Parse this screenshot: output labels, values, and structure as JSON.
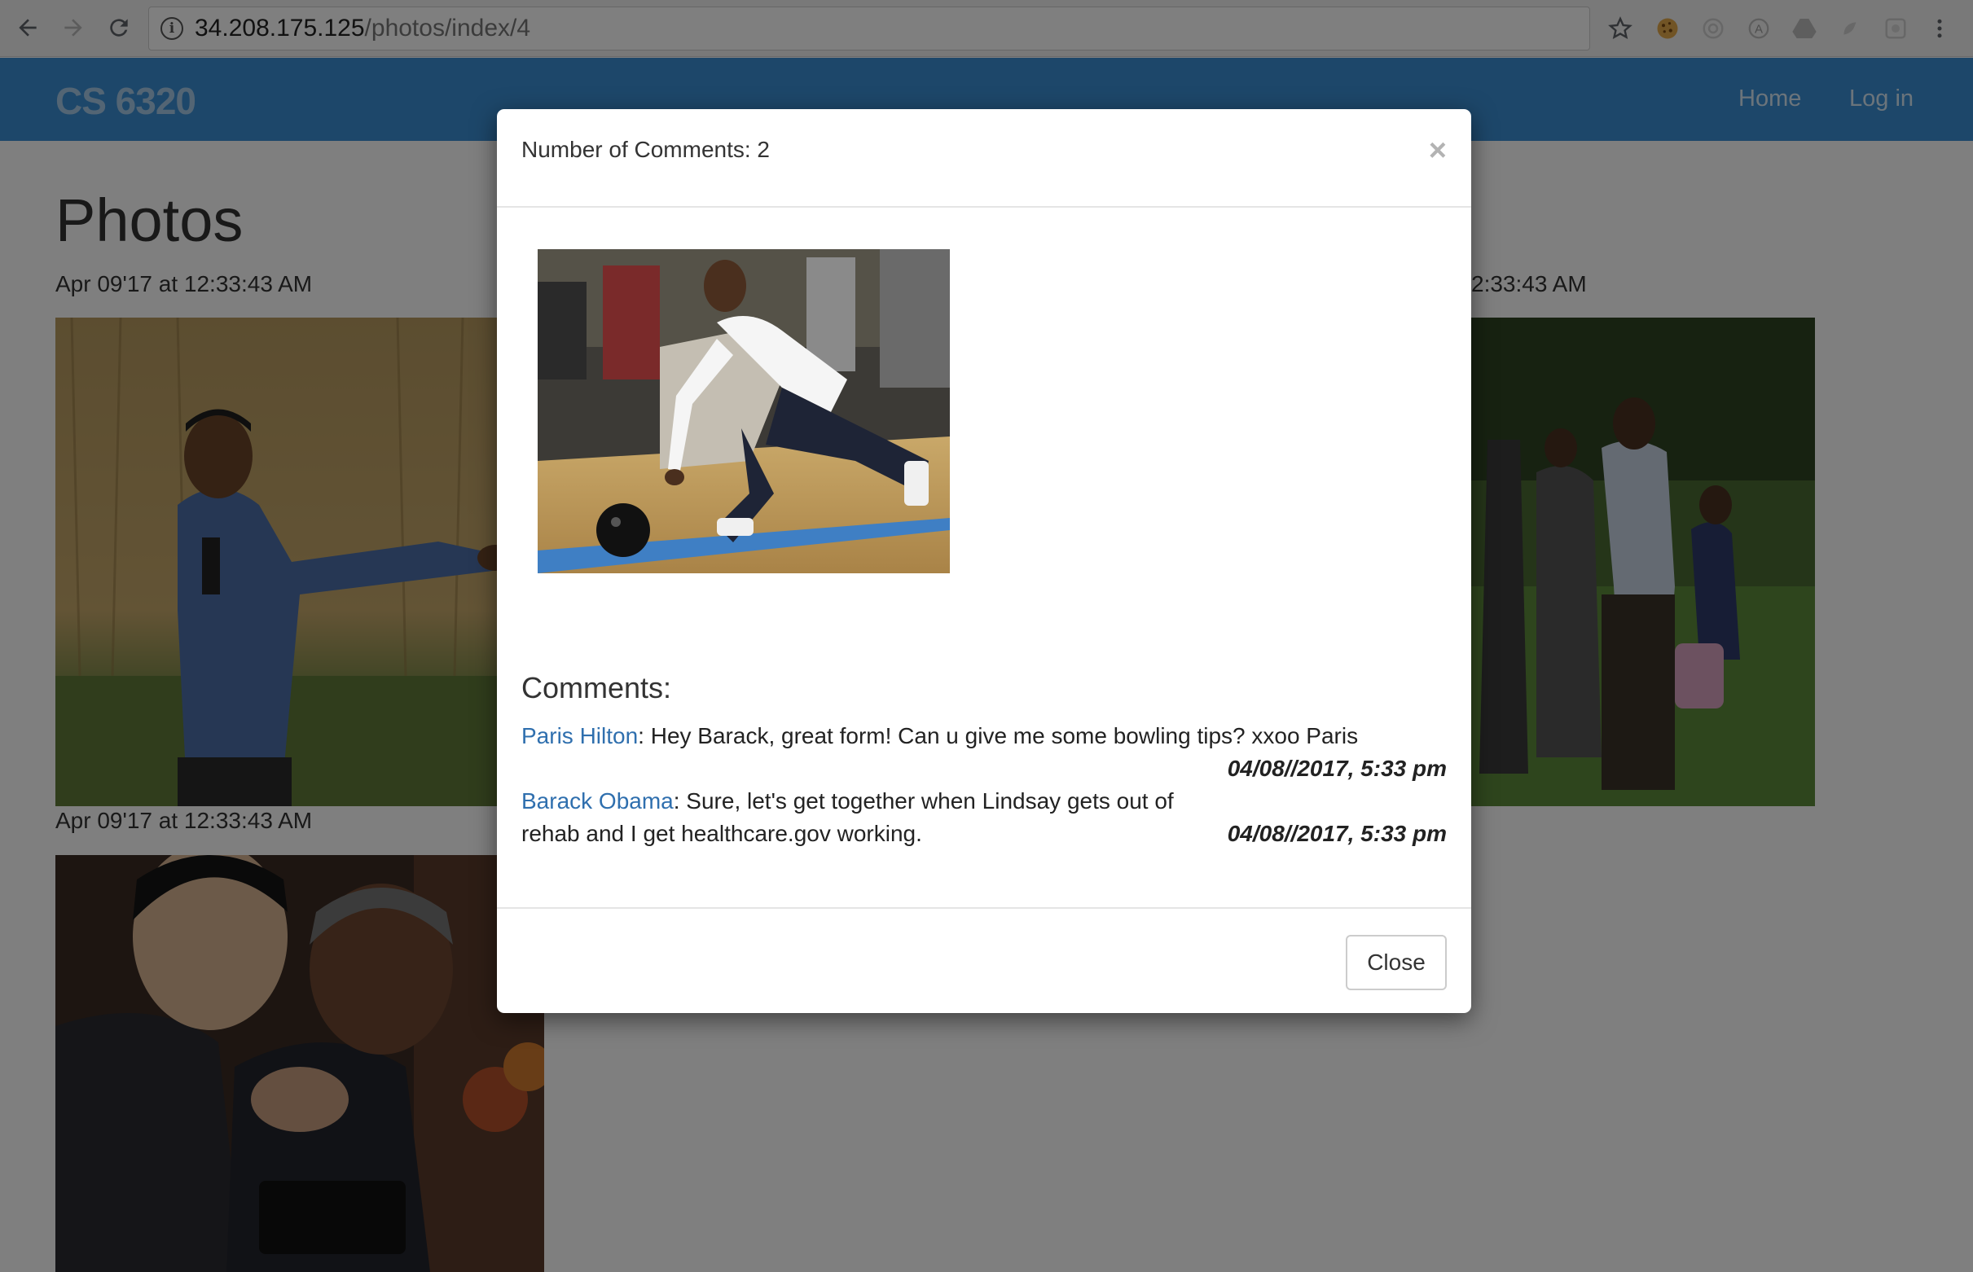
{
  "browser": {
    "url_host": "34.208.175.125",
    "url_path": "/photos/index/4"
  },
  "site": {
    "brand": "CS 6320",
    "nav": {
      "home": "Home",
      "login": "Log in"
    },
    "accent_color": "#3a8fd4"
  },
  "page": {
    "title": "Photos",
    "photos": [
      {
        "date": "Apr 09'17 at 12:33:43 AM",
        "subject": "man-speaking-in-cornfield"
      },
      {
        "date": "2:33:43 AM",
        "subject": "family-walking-on-lawn"
      },
      {
        "date": "Apr 09'17 at 12:33:43 AM",
        "subject": "man-listening-in-meeting"
      }
    ]
  },
  "modal": {
    "title": "Number of Comments: 2",
    "close_x": "×",
    "photo_subject": "man-bowling",
    "comments_heading": "Comments:",
    "comments": [
      {
        "author": "Paris Hilton",
        "text": ": Hey Barack, great form! Can u give me some bowling tips? xxoo Paris",
        "date": "04/08//2017, 5:33 pm"
      },
      {
        "author": "Barack Obama",
        "text": ": Sure, let's get together when Lindsay gets out of rehab and I get healthcare.gov working.",
        "date": "04/08//2017, 5:33 pm"
      }
    ],
    "close_button": "Close"
  }
}
